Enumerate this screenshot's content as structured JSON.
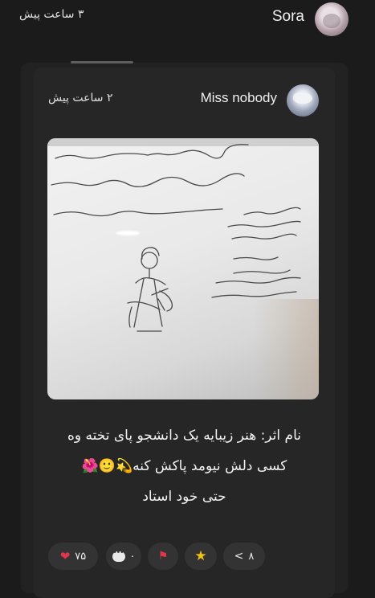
{
  "top_post": {
    "username": "Sora",
    "timestamp": "۳ ساعت پیش"
  },
  "quoted_post": {
    "username": "Miss nobody",
    "timestamp": "۲ ساعت پیش",
    "caption_lines": [
      "نام اثر: هنر زیبایه یک دانشجو پای تخته وه",
      "کسی دلش نیومد پاکش کنه💫🙂🌺",
      "حتی خود استاد"
    ]
  },
  "actions": {
    "likes_count": "۷۵",
    "comments_count": "۰",
    "shares_count": "۸"
  },
  "colors": {
    "background": "#1b1b1c",
    "card": "#262627",
    "pill": "#333334",
    "like": "#e0364a",
    "star": "#f3c01a"
  },
  "icons": [
    "heart-icon",
    "comment-icon",
    "flag-icon",
    "star-icon",
    "share-icon"
  ]
}
